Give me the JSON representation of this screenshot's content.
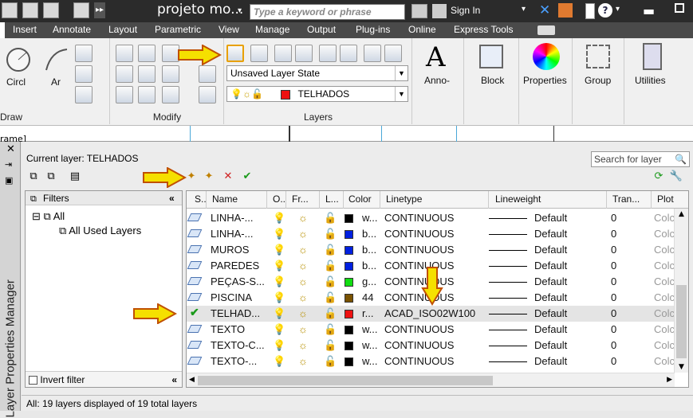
{
  "title_bar": {
    "app_title": "projeto mo...",
    "search_placeholder": "Type a keyword or phrase",
    "sign_in": "Sign In"
  },
  "menu": [
    "Insert",
    "Annotate",
    "Layout",
    "Parametric",
    "View",
    "Manage",
    "Output",
    "Plug-ins",
    "Online",
    "Express Tools"
  ],
  "ribbon": {
    "draw": {
      "label": "Draw",
      "circle_label": "Circl",
      "arc_label": "Ar"
    },
    "modify": {
      "label": "Modify"
    },
    "layers": {
      "label": "Layers",
      "layer_state": "Unsaved Layer State",
      "current_layer": "TELHADOS",
      "current_color": "#ee1111"
    },
    "annotation": {
      "label": "Anno-"
    },
    "block": {
      "label": "Block"
    },
    "properties": {
      "label": "Properties"
    },
    "group": {
      "label": "Group"
    },
    "utilities": {
      "label": "Utilities"
    }
  },
  "drawing_strip_text": "rame]",
  "palette": {
    "title": "Layer Properties Manager",
    "current_layer_label": "Current layer: TELHADOS",
    "search_placeholder": "Search for layer",
    "filters_header": "Filters",
    "filter_all": "All",
    "filter_used": "All Used Layers",
    "invert_filter": "Invert filter",
    "status": "All: 19 layers displayed of 19 total layers"
  },
  "grid": {
    "columns": [
      "S..",
      "Name",
      "O..",
      "Fr...",
      "L...",
      "Color",
      "Linetype",
      "Lineweight",
      "Tran...",
      "Plot"
    ],
    "rows": [
      {
        "name": "LINHA-...",
        "color_name": "w...",
        "color": "#000000",
        "linetype": "CONTINUOUS",
        "lineweight": "Default",
        "trans": "0",
        "plot": "Colc",
        "current": false
      },
      {
        "name": "LINHA-...",
        "color_name": "b...",
        "color": "#0020e0",
        "linetype": "CONTINUOUS",
        "lineweight": "Default",
        "trans": "0",
        "plot": "Colc",
        "current": false
      },
      {
        "name": "MUROS",
        "color_name": "b...",
        "color": "#0020e0",
        "linetype": "CONTINUOUS",
        "lineweight": "Default",
        "trans": "0",
        "plot": "Colc",
        "current": false
      },
      {
        "name": "PAREDES",
        "color_name": "b...",
        "color": "#0020e0",
        "linetype": "CONTINUOUS",
        "lineweight": "Default",
        "trans": "0",
        "plot": "Colc",
        "current": false
      },
      {
        "name": "PEÇAS-S...",
        "color_name": "g...",
        "color": "#11dd11",
        "linetype": "CONTINUOUS",
        "lineweight": "Default",
        "trans": "0",
        "plot": "Colc",
        "current": false
      },
      {
        "name": "PISCINA",
        "color_name": "44",
        "color": "#7a5200",
        "linetype": "CONTINUOUS",
        "lineweight": "Default",
        "trans": "0",
        "plot": "Colc",
        "current": false
      },
      {
        "name": "TELHAD...",
        "color_name": "r...",
        "color": "#ee1111",
        "linetype": "ACAD_ISO02W100",
        "lineweight": "Default",
        "trans": "0",
        "plot": "Colc",
        "current": true
      },
      {
        "name": "TEXTO",
        "color_name": "w...",
        "color": "#000000",
        "linetype": "CONTINUOUS",
        "lineweight": "Default",
        "trans": "0",
        "plot": "Colc",
        "current": false
      },
      {
        "name": "TEXTO-C...",
        "color_name": "w...",
        "color": "#000000",
        "linetype": "CONTINUOUS",
        "lineweight": "Default",
        "trans": "0",
        "plot": "Colc",
        "current": false
      },
      {
        "name": "TEXTO-...",
        "color_name": "w...",
        "color": "#000000",
        "linetype": "CONTINUOUS",
        "lineweight": "Default",
        "trans": "0",
        "plot": "Colc",
        "current": false
      }
    ]
  },
  "accent_arrow_color": "#f5e000"
}
